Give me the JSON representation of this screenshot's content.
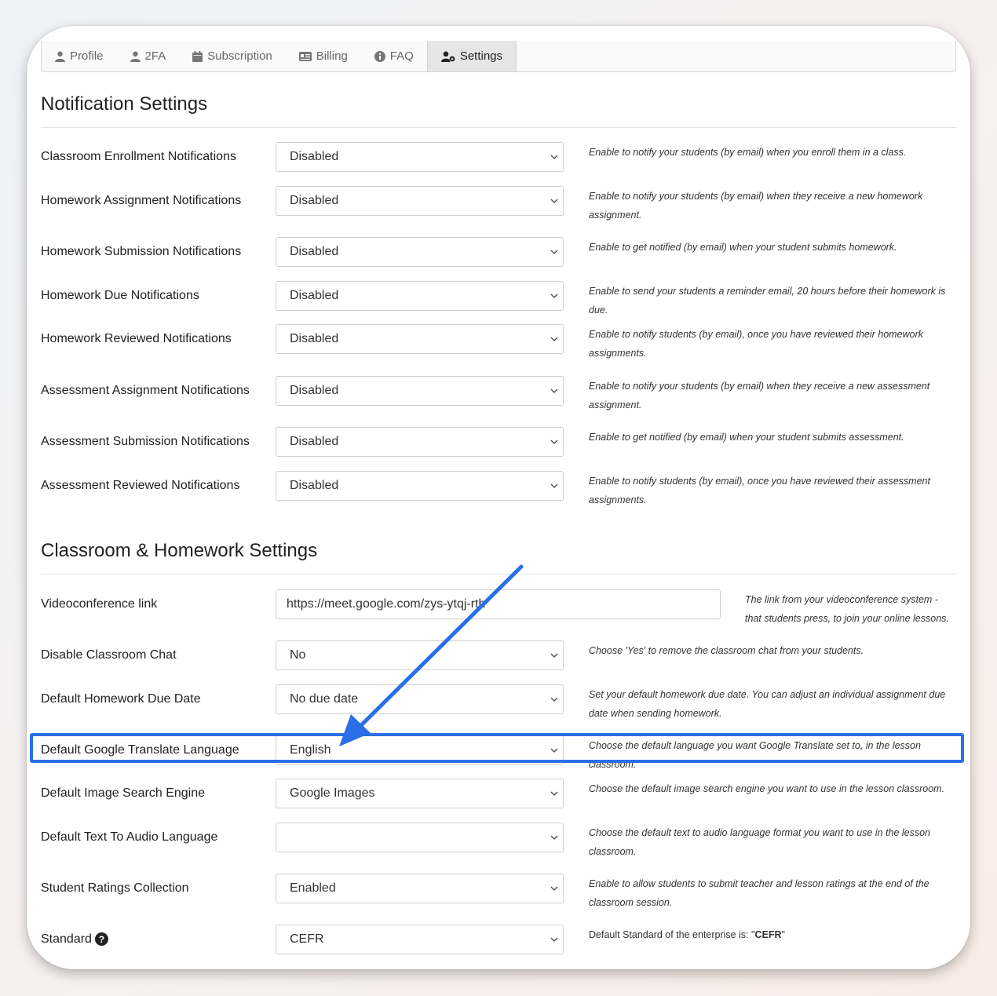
{
  "tabs": [
    {
      "label": "Profile",
      "icon": "user-icon"
    },
    {
      "label": "2FA",
      "icon": "user-icon"
    },
    {
      "label": "Subscription",
      "icon": "calendar-icon"
    },
    {
      "label": "Billing",
      "icon": "id-card-icon"
    },
    {
      "label": "FAQ",
      "icon": "info-circle-icon"
    },
    {
      "label": "Settings",
      "icon": "user-gear-icon",
      "active": true
    }
  ],
  "notification": {
    "title": "Notification Settings",
    "rows": [
      {
        "label": "Classroom Enrollment Notifications",
        "value": "Disabled",
        "help": "Enable to notify your students (by email) when you enroll them in a class."
      },
      {
        "label": "Homework Assignment Notifications",
        "value": "Disabled",
        "help": "Enable to notify your students (by email) when they receive a new homework assignment."
      },
      {
        "label": "Homework Submission Notifications",
        "value": "Disabled",
        "help": "Enable to get notified (by email) when your student submits homework."
      },
      {
        "label": "Homework Due Notifications",
        "value": "Disabled",
        "help": "Enable to send your students a reminder email, 20 hours before their homework is due."
      },
      {
        "label": "Homework Reviewed Notifications",
        "value": "Disabled",
        "help": "Enable to notify students (by email), once you have reviewed their homework assignments."
      },
      {
        "label": "Assessment Assignment Notifications",
        "value": "Disabled",
        "help": "Enable to notify your students (by email) when they receive a new assessment assignment."
      },
      {
        "label": "Assessment Submission Notifications",
        "value": "Disabled",
        "help": "Enable to get notified (by email) when your student submits assessment."
      },
      {
        "label": "Assessment Reviewed Notifications",
        "value": "Disabled",
        "help": "Enable to notify students (by email), once you have reviewed their assessment assignments."
      }
    ]
  },
  "classroom": {
    "title": "Classroom & Homework Settings",
    "video_link": {
      "label": "Videoconference link",
      "value": "https://meet.google.com/zys-ytqj-rth",
      "help": "The link from your videoconference system - that students press, to join your online lessons."
    },
    "rows": [
      {
        "label": "Disable Classroom Chat",
        "value": "No",
        "help": "Choose 'Yes' to remove the classroom chat from your students."
      },
      {
        "label": "Default Homework Due Date",
        "value": "No due date",
        "help": "Set your default homework due date. You can adjust an individual assignment due date when sending homework."
      },
      {
        "label": "Default Google Translate Language",
        "value": "English",
        "help": "Choose the default language you want Google Translate set to, in the lesson classroom."
      },
      {
        "label": "Default Image Search Engine",
        "value": "Google Images",
        "help": "Choose the default image search engine you want to use in the lesson classroom."
      },
      {
        "label": "Default Text To Audio Language",
        "value": "",
        "help": "Choose the default text to audio language format you want to use in the lesson classroom."
      },
      {
        "label": "Student Ratings Collection",
        "value": "Enabled",
        "help": "Enable to allow students to submit teacher and lesson ratings at the end of the classroom session."
      }
    ],
    "standard": {
      "label": "Standard",
      "value": "CEFR",
      "help_prefix": "Default Standard of the enterprise is: \"",
      "help_value": "CEFR",
      "help_suffix": "\""
    }
  },
  "colors": {
    "highlight": "#2a6fe8",
    "arrow": "#2a6fe8"
  }
}
